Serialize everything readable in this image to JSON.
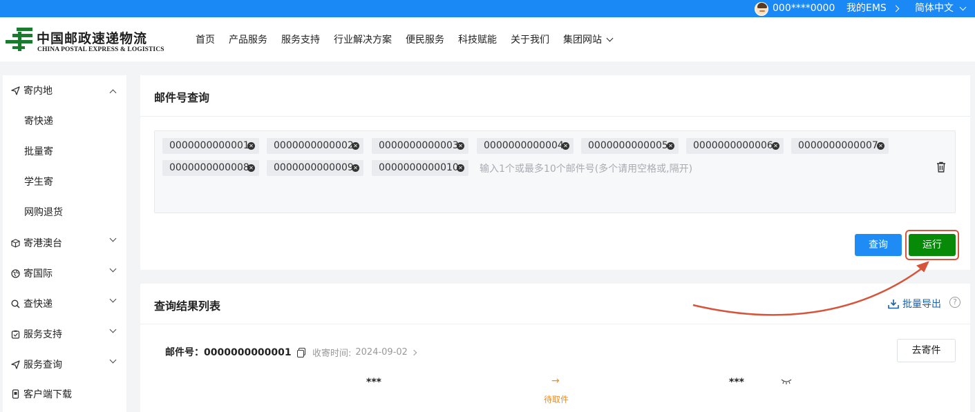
{
  "topbar": {
    "account": "000****0000",
    "my_ems": "我的EMS",
    "language": "简体中文"
  },
  "header": {
    "logo_cn": "中国邮政速递物流",
    "logo_en": "CHINA POSTAL EXPRESS & LOGISTICS",
    "nav": [
      "首页",
      "产品服务",
      "服务支持",
      "行业解决方案",
      "便民服务",
      "科技赋能",
      "关于我们",
      "集团网站"
    ]
  },
  "sidebar": {
    "items": [
      {
        "label": "寄内地",
        "icon": "send-icon",
        "expanded": true
      },
      {
        "label": "寄快递",
        "sub": true
      },
      {
        "label": "批量寄",
        "sub": true
      },
      {
        "label": "学生寄",
        "sub": true
      },
      {
        "label": "网购退货",
        "sub": true
      },
      {
        "label": "寄港澳台",
        "icon": "box-icon"
      },
      {
        "label": "寄国际",
        "icon": "globe-icon"
      },
      {
        "label": "查快递",
        "icon": "search-icon"
      },
      {
        "label": "服务支持",
        "icon": "clipboard-icon"
      },
      {
        "label": "服务查询",
        "icon": "send-icon"
      },
      {
        "label": "客户端下载",
        "icon": "phone-icon"
      }
    ]
  },
  "query": {
    "title": "邮件号查询",
    "tags": [
      "0000000000001",
      "0000000000002",
      "0000000000003",
      "0000000000004",
      "0000000000005",
      "0000000000006",
      "0000000000007",
      "0000000000008",
      "0000000000009",
      "0000000000010"
    ],
    "placeholder": "输入1个或最多10个邮件号(多个请用空格或,隔开)",
    "query_button": "查询",
    "run_button": "运行"
  },
  "results": {
    "title": "查询结果列表",
    "export_label": "批量导出",
    "help": "?",
    "mail_label": "邮件号：",
    "mail_no": "0000000000001",
    "send_time_label": "收寄时间:",
    "send_time": "2024-09-02",
    "go_button": "去寄件",
    "from": "***",
    "to": "***",
    "status_arrow": "→",
    "status": "待取件"
  },
  "colors": {
    "topbar": "#1a88f5",
    "primary_button": "#1f8cf5",
    "run_button": "#078a08",
    "highlight": "#d6543a",
    "status": "#f28c16"
  }
}
